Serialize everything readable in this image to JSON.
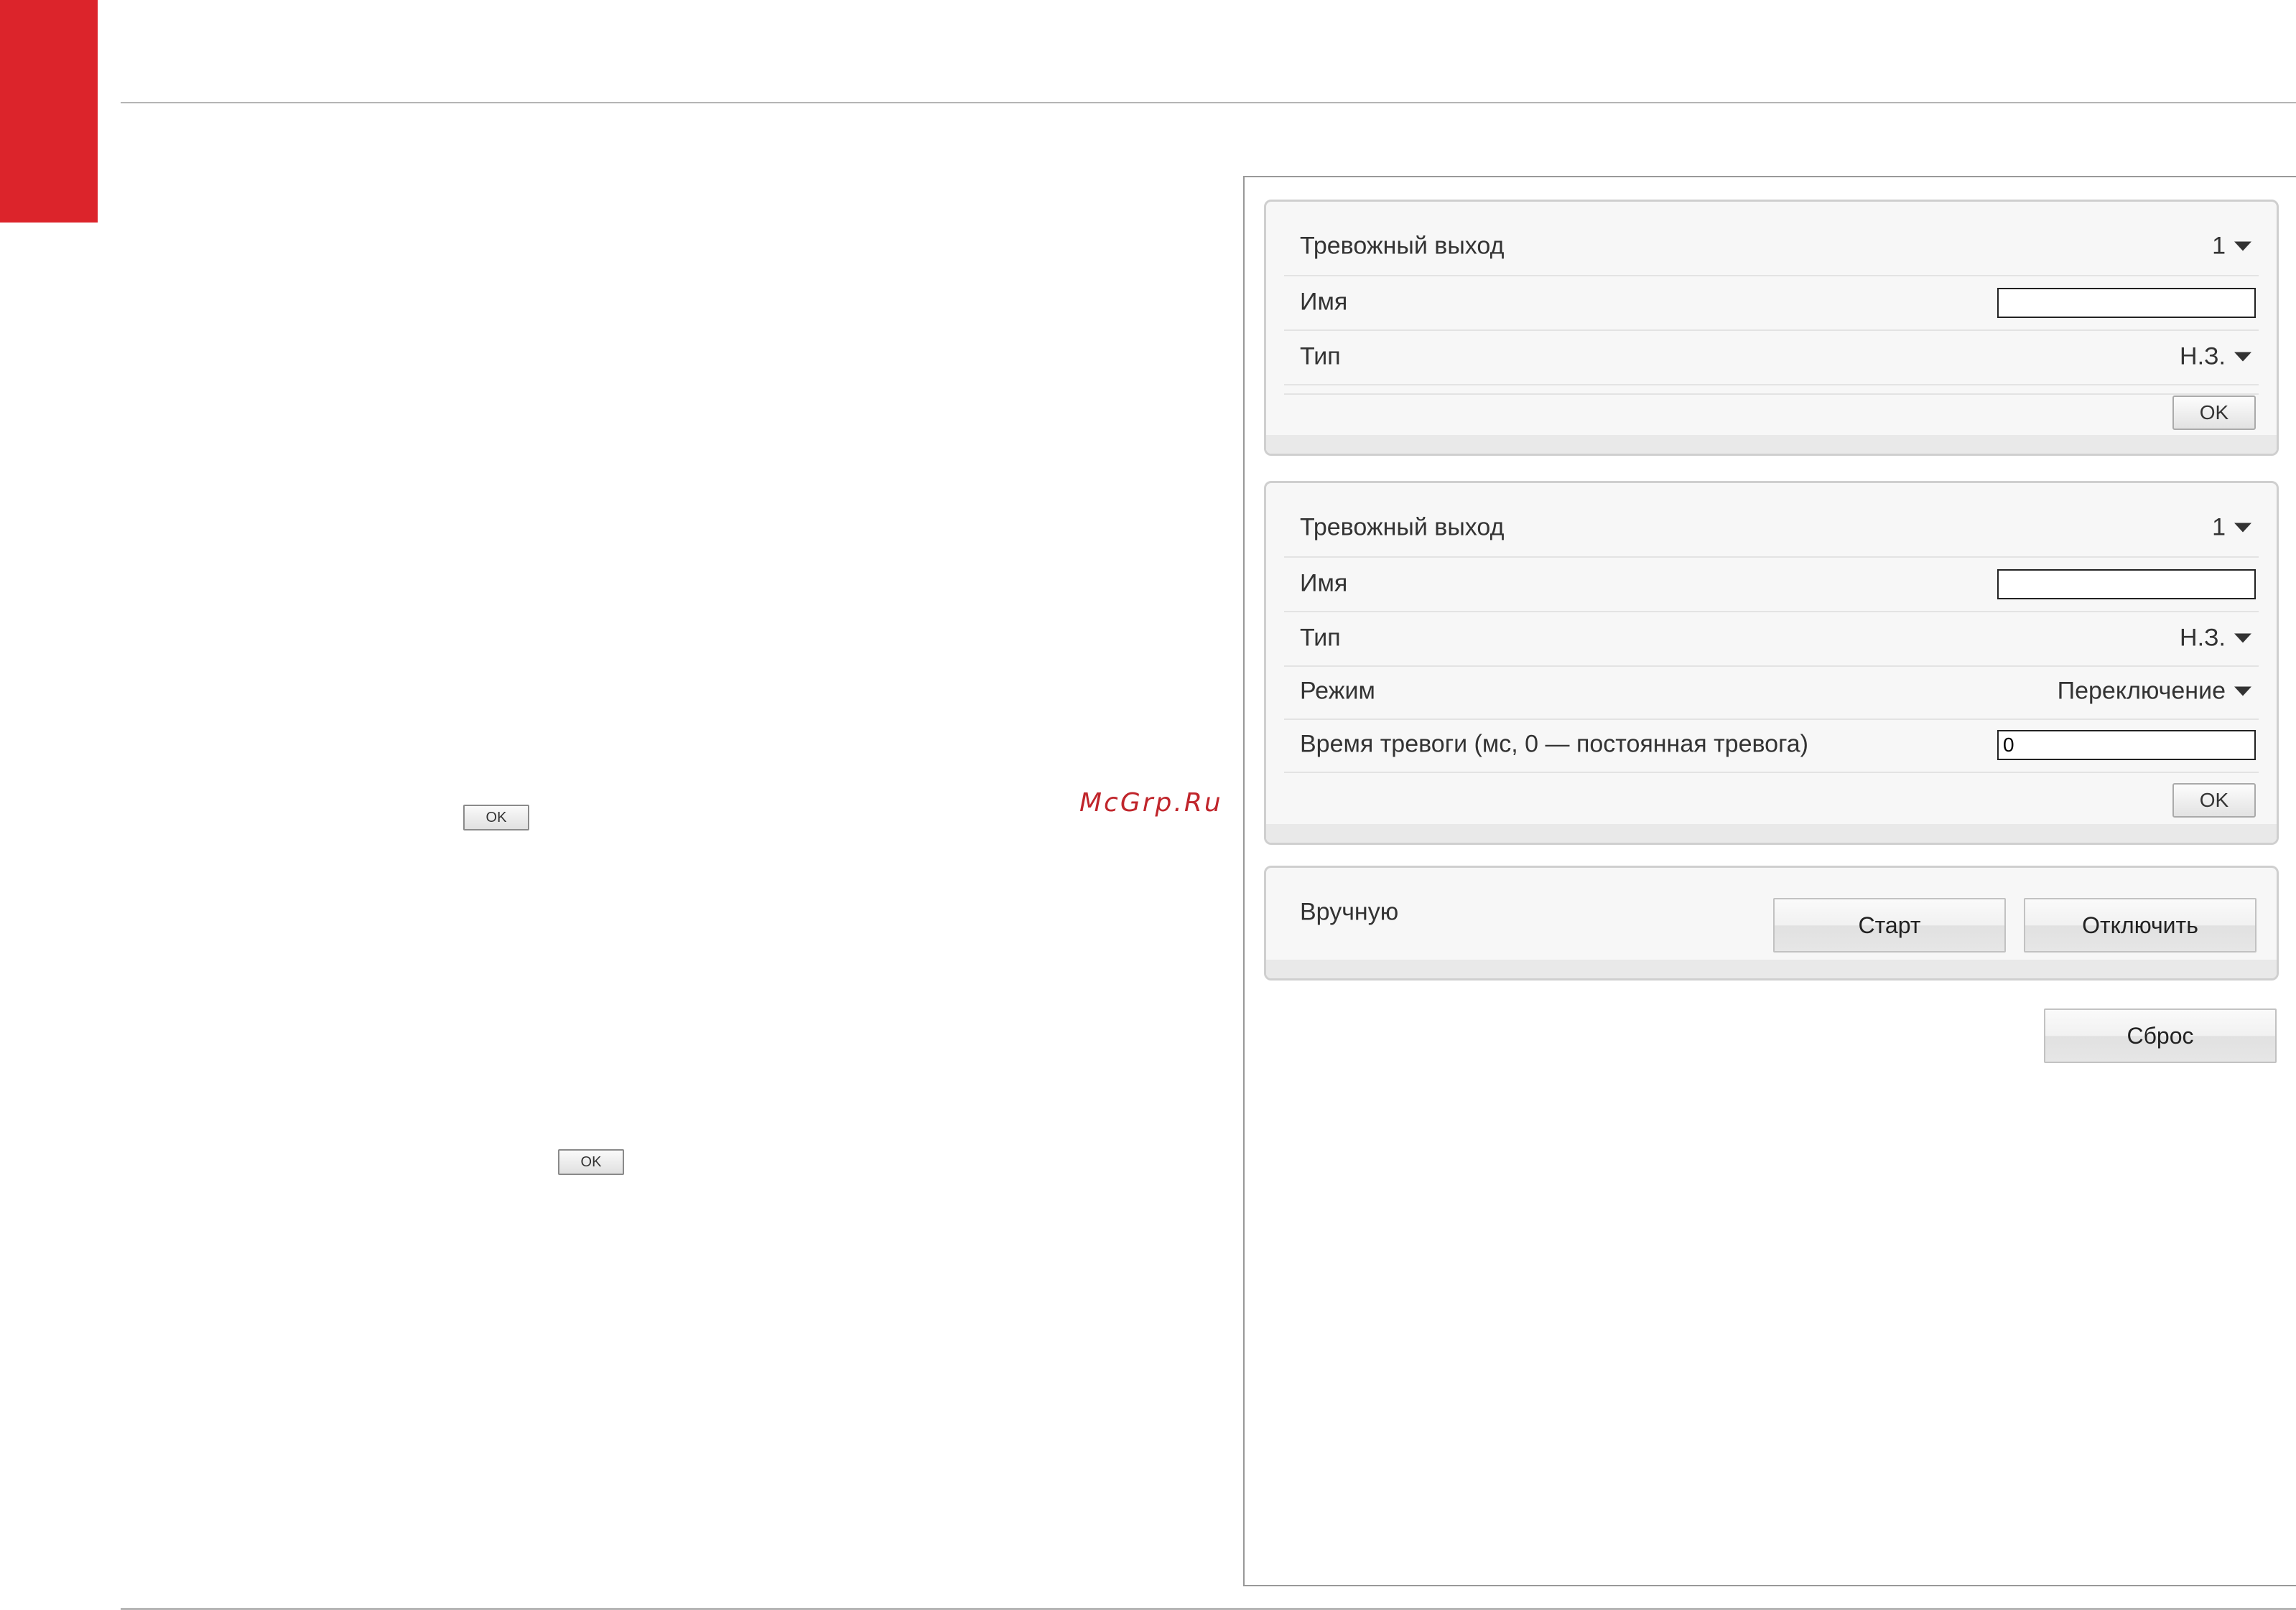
{
  "watermark": "McGrp.Ru",
  "left_buttons": {
    "ok_1": "OK",
    "ok_2": "OK"
  },
  "panel1": {
    "alarm_output_label": "Тревожный выход",
    "alarm_output_value": "1",
    "name_label": "Имя",
    "name_value": "",
    "type_label": "Тип",
    "type_value": "Н.З.",
    "ok_label": "OK"
  },
  "panel2": {
    "alarm_output_label": "Тревожный выход",
    "alarm_output_value": "1",
    "name_label": "Имя",
    "name_value": "",
    "type_label": "Тип",
    "type_value": "Н.З.",
    "mode_label": "Режим",
    "mode_value": "Переключение",
    "alarm_time_label": "Время тревоги (мс, 0 — постоянная тревога)",
    "alarm_time_value": "0",
    "ok_label": "OK"
  },
  "manual": {
    "label": "Вручную",
    "start_label": "Старт",
    "disable_label": "Отключить"
  },
  "reset_label": "Сброс",
  "colors": {
    "accent_red": "#dc242b"
  }
}
